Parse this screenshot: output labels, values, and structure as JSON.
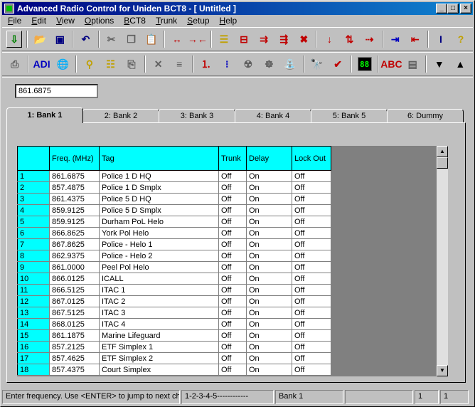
{
  "window": {
    "title": "Advanced Radio Control for Uniden BCT8 - [ Untitled ]"
  },
  "menu": [
    "File",
    "Edit",
    "View",
    "Options",
    "BCT8",
    "Trunk",
    "Setup",
    "Help"
  ],
  "toolbar1": [
    {
      "name": "import-icon",
      "glyph": "⇩",
      "cls": "ic-grn raised"
    },
    {
      "sep": true
    },
    {
      "name": "open-folder-icon",
      "glyph": "📂",
      "cls": "ic-yel"
    },
    {
      "name": "save-icon",
      "glyph": "▣",
      "cls": "ic-navy"
    },
    {
      "sep": true
    },
    {
      "name": "undo-icon",
      "glyph": "↶",
      "cls": "ic-navy"
    },
    {
      "sep": true
    },
    {
      "name": "cut-icon",
      "glyph": "✂",
      "cls": "ic-gray"
    },
    {
      "name": "copy-icon",
      "glyph": "❐",
      "cls": "ic-gray"
    },
    {
      "name": "paste-icon",
      "glyph": "📋",
      "cls": "ic-gray"
    },
    {
      "sep": true
    },
    {
      "name": "expand-columns-icon",
      "glyph": "↔",
      "cls": "ic-red"
    },
    {
      "name": "collapse-columns-icon",
      "glyph": "→←",
      "cls": "ic-red"
    },
    {
      "sep": true
    },
    {
      "name": "align-rows-icon",
      "glyph": "☰",
      "cls": "ic-yel"
    },
    {
      "name": "insert-row-icon",
      "glyph": "⊟",
      "cls": "ic-red"
    },
    {
      "name": "move-row-icon",
      "glyph": "⇉",
      "cls": "ic-red"
    },
    {
      "name": "shift-row-icon",
      "glyph": "⇶",
      "cls": "ic-red"
    },
    {
      "name": "delete-row-icon",
      "glyph": "✖",
      "cls": "ic-red"
    },
    {
      "sep": true
    },
    {
      "name": "sort-desc-icon",
      "glyph": "↓",
      "cls": "ic-red"
    },
    {
      "name": "sort-asc-icon",
      "glyph": "⇅",
      "cls": "ic-red"
    },
    {
      "name": "move-right-icon",
      "glyph": "⇢",
      "cls": "ic-red"
    },
    {
      "sep": true
    },
    {
      "name": "send-to-scanner-icon",
      "glyph": "⇥",
      "cls": "ic-blue"
    },
    {
      "name": "receive-from-scanner-icon",
      "glyph": "⇤",
      "cls": "ic-red"
    },
    {
      "sep": true
    },
    {
      "name": "text-cursor-icon",
      "glyph": "I",
      "cls": "ic-navy"
    },
    {
      "name": "help-icon",
      "glyph": "?",
      "cls": "ic-yel"
    }
  ],
  "toolbar2": [
    {
      "name": "print-icon",
      "glyph": "⎙",
      "cls": "ic-gray"
    },
    {
      "sep": true
    },
    {
      "name": "adi-icon",
      "glyph": "ADI",
      "cls": "ic-blue"
    },
    {
      "name": "globe-icon",
      "glyph": "🌐",
      "cls": "ic-blue"
    },
    {
      "sep": true
    },
    {
      "name": "tree-icon",
      "glyph": "⚲",
      "cls": "ic-yel"
    },
    {
      "name": "list-icon",
      "glyph": "☷",
      "cls": "ic-yel"
    },
    {
      "name": "clipboard-icon",
      "glyph": "⎘",
      "cls": "ic-gray"
    },
    {
      "sep": true
    },
    {
      "name": "clear-icon",
      "glyph": "✕",
      "cls": "ic-gray"
    },
    {
      "name": "lines-icon",
      "glyph": "≡",
      "cls": "ic-gray"
    },
    {
      "sep": true
    },
    {
      "name": "numbered-list-icon",
      "glyph": "⒈",
      "cls": "ic-red"
    },
    {
      "name": "bullet-list-icon",
      "glyph": "⁝",
      "cls": "ic-blue"
    },
    {
      "name": "scan-icon",
      "glyph": "☢",
      "cls": "ic-gray"
    },
    {
      "name": "search-scan-icon",
      "glyph": "☸",
      "cls": "ic-gray"
    },
    {
      "name": "faucet-icon",
      "glyph": "⛲",
      "cls": "ic-blue"
    },
    {
      "sep": true
    },
    {
      "name": "binoculars-icon",
      "glyph": "🔭",
      "cls": "ic-gray"
    },
    {
      "name": "check-icon",
      "glyph": "✔",
      "cls": "ic-red"
    },
    {
      "sep": true
    },
    {
      "name": "led-display-icon",
      "glyph": "88",
      "cls": "led"
    },
    {
      "sep": true
    },
    {
      "name": "abc-sort-icon",
      "glyph": "ABC",
      "cls": "ic-red"
    },
    {
      "name": "display-icon",
      "glyph": "▤",
      "cls": "ic-gray"
    },
    {
      "sep": true
    },
    {
      "name": "arrow-down-icon",
      "glyph": "▼",
      "cls": ""
    },
    {
      "name": "arrow-up-icon",
      "glyph": "▲",
      "cls": ""
    }
  ],
  "frequency_input": {
    "value": "861.6875"
  },
  "tabs": [
    "1: Bank 1",
    "2: Bank 2",
    "3: Bank 3",
    "4: Bank 4",
    "5: Bank 5",
    "6: Dummy"
  ],
  "active_tab": 0,
  "grid": {
    "headers": [
      "",
      "Freq. (MHz)",
      "Tag",
      "Trunk",
      "Delay",
      "Lock Out"
    ],
    "rows": [
      [
        "1",
        "861.6875",
        "Police 1 D HQ",
        "Off",
        "On",
        "Off"
      ],
      [
        "2",
        "857.4875",
        "Police 1 D Smplx",
        "Off",
        "On",
        "Off"
      ],
      [
        "3",
        "861.4375",
        "Police 5 D HQ",
        "Off",
        "On",
        "Off"
      ],
      [
        "4",
        "859.9125",
        "Police 5 D Smplx",
        "Off",
        "On",
        "Off"
      ],
      [
        "5",
        "859.9125",
        "Durham PoL Helo",
        "Off",
        "On",
        "Off"
      ],
      [
        "6",
        "866.8625",
        "York Pol Helo",
        "Off",
        "On",
        "Off"
      ],
      [
        "7",
        "867.8625",
        "Police - Helo 1",
        "Off",
        "On",
        "Off"
      ],
      [
        "8",
        "862.9375",
        "Police - Helo 2",
        "Off",
        "On",
        "Off"
      ],
      [
        "9",
        "861.0000",
        "Peel Pol  Helo",
        "Off",
        "On",
        "Off"
      ],
      [
        "10",
        "866.0125",
        "ICALL",
        "Off",
        "On",
        "Off"
      ],
      [
        "11",
        "866.5125",
        "ITAC 1",
        "Off",
        "On",
        "Off"
      ],
      [
        "12",
        "867.0125",
        "ITAC 2",
        "Off",
        "On",
        "Off"
      ],
      [
        "13",
        "867.5125",
        "ITAC 3",
        "Off",
        "On",
        "Off"
      ],
      [
        "14",
        "868.0125",
        "ITAC 4",
        "Off",
        "On",
        "Off"
      ],
      [
        "15",
        "861.1875",
        "Marine Lifeguard",
        "Off",
        "On",
        "Off"
      ],
      [
        "16",
        "857.2125",
        "ETF Simplex 1",
        "Off",
        "On",
        "Off"
      ],
      [
        "17",
        "857.4625",
        "ETF Simplex 2",
        "Off",
        "On",
        "Off"
      ],
      [
        "18",
        "857.4375",
        "Court Simplex",
        "Off",
        "On",
        "Off"
      ]
    ]
  },
  "status": {
    "hint": "Enter frequency. Use <ENTER> to jump to next cha",
    "pattern": "1-2-3-4-5------------",
    "blank1": "",
    "bank": "Bank 1",
    "blank2": "",
    "col": "1",
    "row": "1"
  }
}
